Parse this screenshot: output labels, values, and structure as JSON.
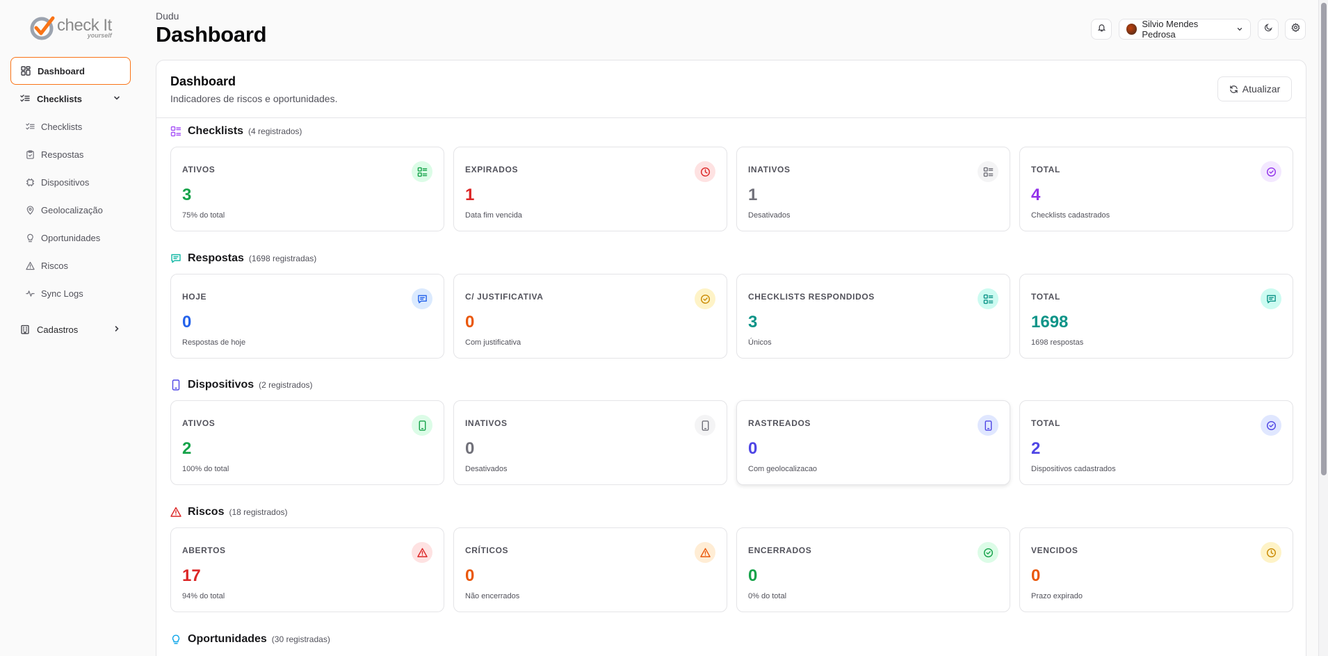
{
  "brand": {
    "name_main": "check It",
    "name_sub": "yourself"
  },
  "sidebar": {
    "dashboard": "Dashboard",
    "checklists_group": "Checklists",
    "sub": [
      "Checklists",
      "Respostas",
      "Dispositivos",
      "Geolocalização",
      "Oportunidades",
      "Riscos",
      "Sync Logs"
    ],
    "cadastros": "Cadastros"
  },
  "header": {
    "org": "Dudu",
    "title": "Dashboard",
    "user": "Silvio Mendes Pedrosa"
  },
  "card": {
    "title": "Dashboard",
    "subtitle": "Indicadores de riscos e oportunidades.",
    "refresh": "Atualizar"
  },
  "sections": {
    "checklists": {
      "title": "Checklists",
      "count": "(4 registrados)",
      "stats": [
        {
          "label": "ATIVOS",
          "value": "3",
          "desc": "75% do total"
        },
        {
          "label": "EXPIRADOS",
          "value": "1",
          "desc": "Data fim vencida"
        },
        {
          "label": "INATIVOS",
          "value": "1",
          "desc": "Desativados"
        },
        {
          "label": "TOTAL",
          "value": "4",
          "desc": "Checklists cadastrados"
        }
      ]
    },
    "respostas": {
      "title": "Respostas",
      "count": "(1698 registradas)",
      "stats": [
        {
          "label": "HOJE",
          "value": "0",
          "desc": "Respostas de hoje"
        },
        {
          "label": "C/ JUSTIFICATIVA",
          "value": "0",
          "desc": "Com justificativa"
        },
        {
          "label": "CHECKLISTS RESPONDIDOS",
          "value": "3",
          "desc": "Únicos"
        },
        {
          "label": "TOTAL",
          "value": "1698",
          "desc": "1698 respostas"
        }
      ]
    },
    "dispositivos": {
      "title": "Dispositivos",
      "count": "(2 registrados)",
      "stats": [
        {
          "label": "ATIVOS",
          "value": "2",
          "desc": "100% do total"
        },
        {
          "label": "INATIVOS",
          "value": "0",
          "desc": "Desativados"
        },
        {
          "label": "RASTREADOS",
          "value": "0",
          "desc": "Com geolocalizacao"
        },
        {
          "label": "TOTAL",
          "value": "2",
          "desc": "Dispositivos cadastrados"
        }
      ]
    },
    "riscos": {
      "title": "Riscos",
      "count": "(18 registrados)",
      "stats": [
        {
          "label": "ABERTOS",
          "value": "17",
          "desc": "94% do total"
        },
        {
          "label": "CRÍTICOS",
          "value": "0",
          "desc": "Não encerrados"
        },
        {
          "label": "ENCERRADOS",
          "value": "0",
          "desc": "0% do total"
        },
        {
          "label": "VENCIDOS",
          "value": "0",
          "desc": "Prazo expirado"
        }
      ]
    },
    "oportunidades": {
      "title": "Oportunidades",
      "count": "(30 registradas)"
    }
  },
  "colors": {
    "accent": "#f97316",
    "green": "#16a34a",
    "red": "#dc2626",
    "gray": "#71717a",
    "purple": "#9333ea",
    "blue": "#2563eb",
    "orange": "#ea580c",
    "teal": "#0d9488",
    "indigo": "#4f46e5"
  }
}
